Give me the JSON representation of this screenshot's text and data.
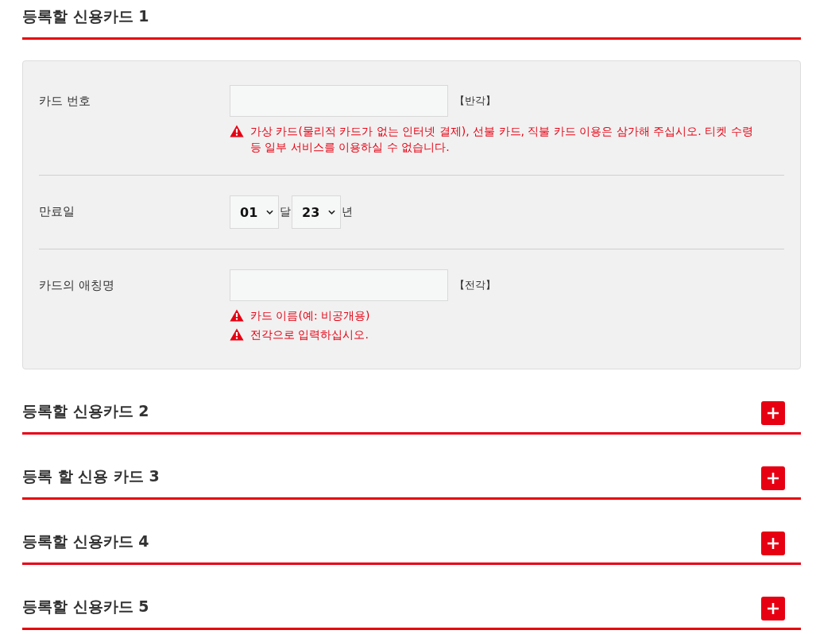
{
  "sections": [
    {
      "title": "등록할 신용카드 1",
      "expanded": true,
      "fields": [
        {
          "kind": "text",
          "label": "카드 번호",
          "hint": "【반각】",
          "warnings": [
            "가상 카드(물리적 카드가 없는 인터넷 결제), 선불 카드, 직불 카드 이용은 삼가해 주십시오. 티켓 수령 등 일부 서비스를 이용하실 수 없습니다."
          ]
        },
        {
          "kind": "date",
          "label": "만료일",
          "selects": [
            {
              "value": "01",
              "unit": "달"
            },
            {
              "value": "23",
              "unit": "년"
            }
          ]
        },
        {
          "kind": "text",
          "label": "카드의 애칭명",
          "hint": "【전각】",
          "warnings": [
            "카드 이름(예: 비공개용)",
            "전각으로 입력하십시오."
          ]
        }
      ]
    },
    {
      "title": "등록할 신용카드 2",
      "expanded": false
    },
    {
      "title": "등록 할 신용 카드 3",
      "expanded": false
    },
    {
      "title": "등록할 신용카드 4",
      "expanded": false
    },
    {
      "title": "등록할 신용카드 5",
      "expanded": false
    }
  ]
}
